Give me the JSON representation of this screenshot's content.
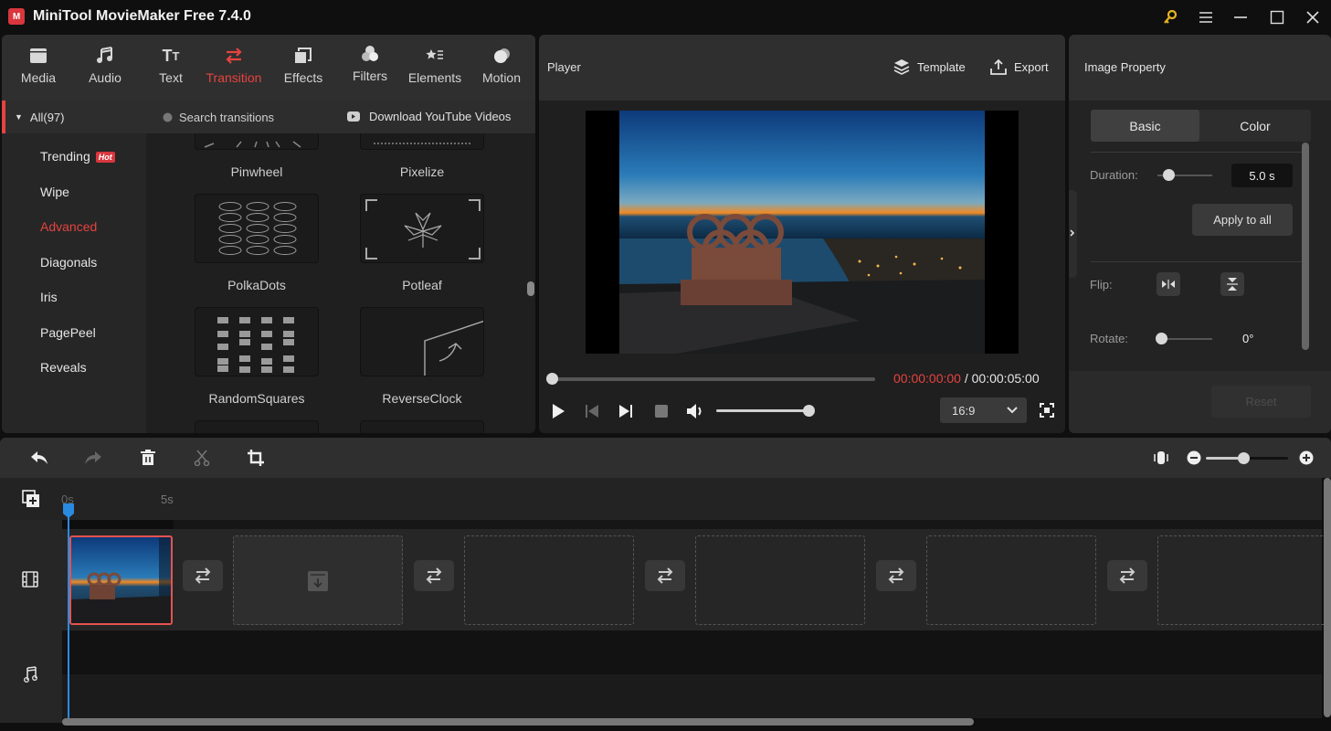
{
  "app": {
    "title": "MiniTool MovieMaker Free 7.4.0",
    "logo_glyph": "M",
    "accent": "#e5433f"
  },
  "window_controls": {
    "key_icon": "key-icon",
    "menu_icon": "menu-icon",
    "minimize": "minimize-icon",
    "maximize": "maximize-icon",
    "close": "close-icon"
  },
  "toolbar": {
    "items": [
      {
        "label": "Media",
        "icon": "folder-icon"
      },
      {
        "label": "Audio",
        "icon": "music-icon"
      },
      {
        "label": "Text",
        "icon": "text-icon"
      },
      {
        "label": "Transition",
        "icon": "transition-icon",
        "active": true
      },
      {
        "label": "Effects",
        "icon": "effects-icon"
      },
      {
        "label": "Filters",
        "icon": "filters-icon"
      },
      {
        "label": "Elements",
        "icon": "elements-icon"
      },
      {
        "label": "Motion",
        "icon": "motion-icon"
      }
    ]
  },
  "categories": {
    "all_label": "All(97)",
    "items": [
      {
        "label": "Trending",
        "badge": "Hot"
      },
      {
        "label": "Wipe"
      },
      {
        "label": "Advanced",
        "active": true
      },
      {
        "label": "Diagonals"
      },
      {
        "label": "Iris"
      },
      {
        "label": "PagePeel"
      },
      {
        "label": "Reveals"
      }
    ]
  },
  "search": {
    "placeholder": "Search transitions",
    "download_label": "Download YouTube Videos"
  },
  "transitions": [
    "Pinwheel",
    "Pixelize",
    "PolkaDots",
    "Potleaf",
    "RandomSquares",
    "ReverseClock"
  ],
  "player": {
    "title": "Player",
    "template_label": "Template",
    "export_label": "Export",
    "current_time": "00:00:00:00",
    "separator": " / ",
    "total_time": "00:00:05:00",
    "progress": 0,
    "volume": 1.0,
    "aspect_ratio": "16:9"
  },
  "property": {
    "title": "Image Property",
    "tabs": [
      {
        "label": "Basic",
        "active": true
      },
      {
        "label": "Color"
      }
    ],
    "duration_label": "Duration:",
    "duration_value": "5.0 s",
    "apply_all_label": "Apply to all",
    "flip_label": "Flip:",
    "rotate_label": "Rotate:",
    "rotate_value": "0°",
    "reset_label": "Reset"
  },
  "timeline": {
    "ruler": [
      "0s",
      "5s"
    ],
    "zoom_level": 0.45
  }
}
